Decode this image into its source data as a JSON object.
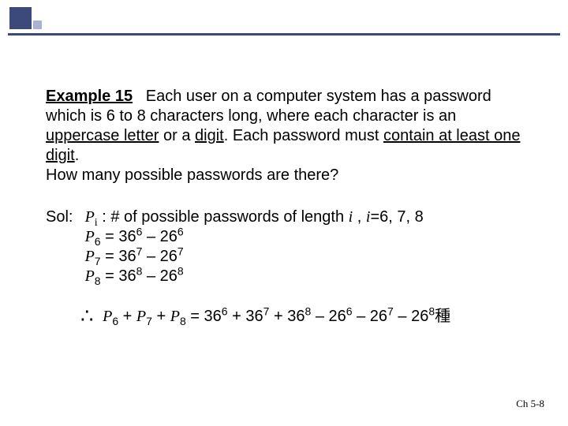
{
  "example_label": "Example 15",
  "problem": {
    "p1a": "Each user on a computer system has a password which is 6 to 8 characters long, where each character is an ",
    "u1": "uppercase letter",
    "p1b": " or a ",
    "u2": "digit",
    "p1c": ". Each password must ",
    "u3": "contain at least one digit",
    "p1d": ".",
    "p2": "How many possible passwords are there?"
  },
  "sol_label": "Sol:",
  "sol": {
    "def_a": " : # of possible passwords of length ",
    "def_b": " , ",
    "def_c": "=6, 7, 8",
    "p6": " = 36",
    "p6b": " – 26",
    "p7": " = 36",
    "p7b": " – 26",
    "p8": " = 36",
    "p8b": " – 26",
    "e6": "6",
    "e7": "7",
    "e8": "8"
  },
  "concl": {
    "a": " + ",
    "eq": " = 36",
    "plus": " + 36",
    "minus": " – 26",
    "suffix": "種"
  },
  "footer": "Ch 5-8"
}
